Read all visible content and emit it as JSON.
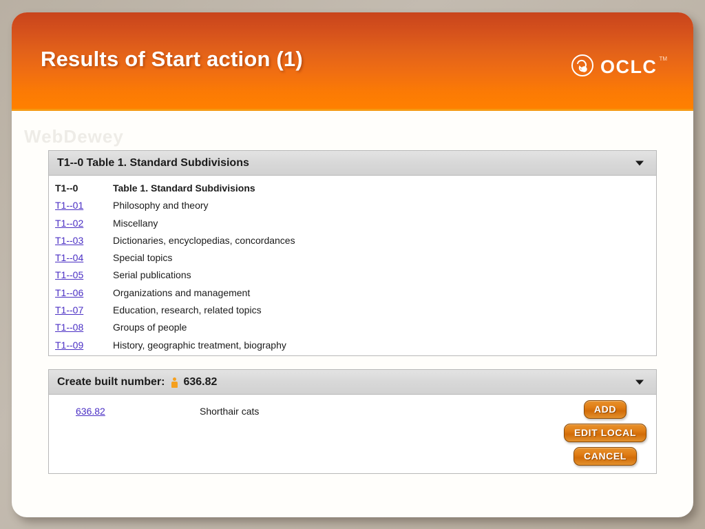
{
  "slide": {
    "title": "Results of Start action (1)",
    "watermark": "WebDewey"
  },
  "branding": {
    "logo_name": "oclc-logo",
    "logo_text": "OCLC",
    "trademark": "TM"
  },
  "colors": {
    "header_gradient_top": "#C8441C",
    "header_gradient_bottom": "#FF8000",
    "header_underline": "#F59A12",
    "backdrop": "#B9B0A3",
    "slide_card": "#FFFEFB",
    "panel_header": "#D8D8D8",
    "panel_border": "#B8B8B8",
    "link": "#4A2FC4",
    "button_orange": "#E07D16",
    "person_icon": "#F5A01E"
  },
  "subdivisions_panel": {
    "header_title": "T1--0 Table 1. Standard Subdivisions",
    "chevron_icon": "chevron-down-icon",
    "rows": [
      {
        "code": "T1--0",
        "label": "Table 1. Standard Subdivisions",
        "is_link": false,
        "is_head": true
      },
      {
        "code": "T1--01",
        "label": "Philosophy and theory",
        "is_link": true,
        "is_head": false
      },
      {
        "code": "T1--02",
        "label": "Miscellany",
        "is_link": true,
        "is_head": false
      },
      {
        "code": "T1--03",
        "label": "Dictionaries, encyclopedias, concordances",
        "is_link": true,
        "is_head": false
      },
      {
        "code": "T1--04",
        "label": "Special topics",
        "is_link": true,
        "is_head": false
      },
      {
        "code": "T1--05",
        "label": "Serial publications",
        "is_link": true,
        "is_head": false
      },
      {
        "code": "T1--06",
        "label": "Organizations and management",
        "is_link": true,
        "is_head": false
      },
      {
        "code": "T1--07",
        "label": "Education, research, related topics",
        "is_link": true,
        "is_head": false
      },
      {
        "code": "T1--08",
        "label": "Groups of people",
        "is_link": true,
        "is_head": false
      },
      {
        "code": "T1--09",
        "label": "History, geographic treatment, biography",
        "is_link": true,
        "is_head": false
      }
    ]
  },
  "built_number_panel": {
    "header_label": "Create built number:",
    "header_icon": "person-icon",
    "header_value": "636.82",
    "chevron_icon": "chevron-down-icon",
    "row": {
      "code": "636.82",
      "label": "Shorthair cats"
    },
    "buttons": [
      {
        "label": "ADD",
        "name": "add-button"
      },
      {
        "label": "EDIT LOCAL",
        "name": "edit-local-button"
      },
      {
        "label": "CANCEL",
        "name": "cancel-button"
      }
    ]
  }
}
